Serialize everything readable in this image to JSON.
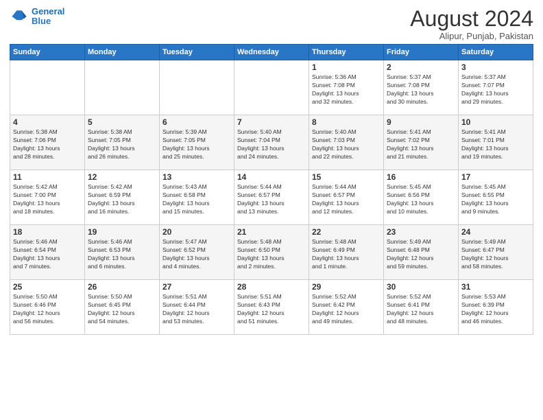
{
  "header": {
    "logo_line1": "General",
    "logo_line2": "Blue",
    "month_year": "August 2024",
    "location": "Alipur, Punjab, Pakistan"
  },
  "days_of_week": [
    "Sunday",
    "Monday",
    "Tuesday",
    "Wednesday",
    "Thursday",
    "Friday",
    "Saturday"
  ],
  "weeks": [
    [
      {
        "day": "",
        "info": ""
      },
      {
        "day": "",
        "info": ""
      },
      {
        "day": "",
        "info": ""
      },
      {
        "day": "",
        "info": ""
      },
      {
        "day": "1",
        "info": "Sunrise: 5:36 AM\nSunset: 7:08 PM\nDaylight: 13 hours\nand 32 minutes."
      },
      {
        "day": "2",
        "info": "Sunrise: 5:37 AM\nSunset: 7:08 PM\nDaylight: 13 hours\nand 30 minutes."
      },
      {
        "day": "3",
        "info": "Sunrise: 5:37 AM\nSunset: 7:07 PM\nDaylight: 13 hours\nand 29 minutes."
      }
    ],
    [
      {
        "day": "4",
        "info": "Sunrise: 5:38 AM\nSunset: 7:06 PM\nDaylight: 13 hours\nand 28 minutes."
      },
      {
        "day": "5",
        "info": "Sunrise: 5:38 AM\nSunset: 7:05 PM\nDaylight: 13 hours\nand 26 minutes."
      },
      {
        "day": "6",
        "info": "Sunrise: 5:39 AM\nSunset: 7:05 PM\nDaylight: 13 hours\nand 25 minutes."
      },
      {
        "day": "7",
        "info": "Sunrise: 5:40 AM\nSunset: 7:04 PM\nDaylight: 13 hours\nand 24 minutes."
      },
      {
        "day": "8",
        "info": "Sunrise: 5:40 AM\nSunset: 7:03 PM\nDaylight: 13 hours\nand 22 minutes."
      },
      {
        "day": "9",
        "info": "Sunrise: 5:41 AM\nSunset: 7:02 PM\nDaylight: 13 hours\nand 21 minutes."
      },
      {
        "day": "10",
        "info": "Sunrise: 5:41 AM\nSunset: 7:01 PM\nDaylight: 13 hours\nand 19 minutes."
      }
    ],
    [
      {
        "day": "11",
        "info": "Sunrise: 5:42 AM\nSunset: 7:00 PM\nDaylight: 13 hours\nand 18 minutes."
      },
      {
        "day": "12",
        "info": "Sunrise: 5:42 AM\nSunset: 6:59 PM\nDaylight: 13 hours\nand 16 minutes."
      },
      {
        "day": "13",
        "info": "Sunrise: 5:43 AM\nSunset: 6:58 PM\nDaylight: 13 hours\nand 15 minutes."
      },
      {
        "day": "14",
        "info": "Sunrise: 5:44 AM\nSunset: 6:57 PM\nDaylight: 13 hours\nand 13 minutes."
      },
      {
        "day": "15",
        "info": "Sunrise: 5:44 AM\nSunset: 6:57 PM\nDaylight: 13 hours\nand 12 minutes."
      },
      {
        "day": "16",
        "info": "Sunrise: 5:45 AM\nSunset: 6:56 PM\nDaylight: 13 hours\nand 10 minutes."
      },
      {
        "day": "17",
        "info": "Sunrise: 5:45 AM\nSunset: 6:55 PM\nDaylight: 13 hours\nand 9 minutes."
      }
    ],
    [
      {
        "day": "18",
        "info": "Sunrise: 5:46 AM\nSunset: 6:54 PM\nDaylight: 13 hours\nand 7 minutes."
      },
      {
        "day": "19",
        "info": "Sunrise: 5:46 AM\nSunset: 6:53 PM\nDaylight: 13 hours\nand 6 minutes."
      },
      {
        "day": "20",
        "info": "Sunrise: 5:47 AM\nSunset: 6:52 PM\nDaylight: 13 hours\nand 4 minutes."
      },
      {
        "day": "21",
        "info": "Sunrise: 5:48 AM\nSunset: 6:50 PM\nDaylight: 13 hours\nand 2 minutes."
      },
      {
        "day": "22",
        "info": "Sunrise: 5:48 AM\nSunset: 6:49 PM\nDaylight: 13 hours\nand 1 minute."
      },
      {
        "day": "23",
        "info": "Sunrise: 5:49 AM\nSunset: 6:48 PM\nDaylight: 12 hours\nand 59 minutes."
      },
      {
        "day": "24",
        "info": "Sunrise: 5:49 AM\nSunset: 6:47 PM\nDaylight: 12 hours\nand 58 minutes."
      }
    ],
    [
      {
        "day": "25",
        "info": "Sunrise: 5:50 AM\nSunset: 6:46 PM\nDaylight: 12 hours\nand 56 minutes."
      },
      {
        "day": "26",
        "info": "Sunrise: 5:50 AM\nSunset: 6:45 PM\nDaylight: 12 hours\nand 54 minutes."
      },
      {
        "day": "27",
        "info": "Sunrise: 5:51 AM\nSunset: 6:44 PM\nDaylight: 12 hours\nand 53 minutes."
      },
      {
        "day": "28",
        "info": "Sunrise: 5:51 AM\nSunset: 6:43 PM\nDaylight: 12 hours\nand 51 minutes."
      },
      {
        "day": "29",
        "info": "Sunrise: 5:52 AM\nSunset: 6:42 PM\nDaylight: 12 hours\nand 49 minutes."
      },
      {
        "day": "30",
        "info": "Sunrise: 5:52 AM\nSunset: 6:41 PM\nDaylight: 12 hours\nand 48 minutes."
      },
      {
        "day": "31",
        "info": "Sunrise: 5:53 AM\nSunset: 6:39 PM\nDaylight: 12 hours\nand 46 minutes."
      }
    ]
  ]
}
